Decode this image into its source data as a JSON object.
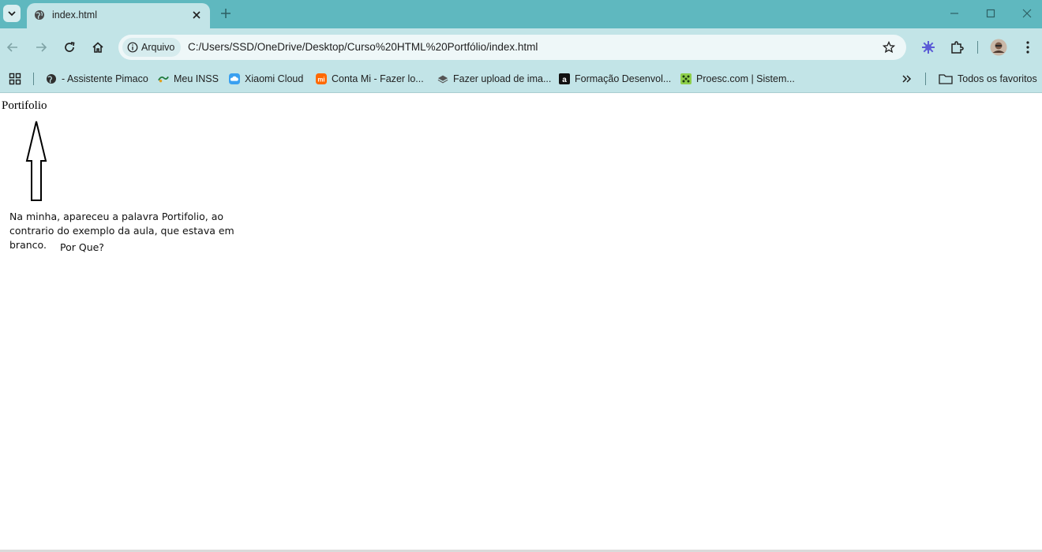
{
  "browser": {
    "tab": {
      "title": "index.html"
    },
    "address": {
      "security_label": "Arquivo",
      "url": "C:/Users/SSD/OneDrive/Desktop/Curso%20HTML%20Portfólio/index.html"
    },
    "bookmarks": [
      {
        "label": "- Assistente Pimaco",
        "icon": "globe-icon"
      },
      {
        "label": "Meu INSS",
        "icon": "inss-icon"
      },
      {
        "label": "Xiaomi Cloud",
        "icon": "cloud-icon"
      },
      {
        "label": "Conta Mi - Fazer lo...",
        "icon": "mi-icon"
      },
      {
        "label": "Fazer upload de ima...",
        "icon": "layers-icon"
      },
      {
        "label": "Formação Desenvol...",
        "icon": "a-icon"
      },
      {
        "label": "Proesc.com | Sistem...",
        "icon": "proesc-icon"
      }
    ],
    "all_bookmarks_label": "Todos os favoritos",
    "colors": {
      "frame": "#5fb8bf",
      "toolbar": "#c2e4e7",
      "omnibox": "#eef7f8"
    }
  },
  "page": {
    "heading": "Portifolio",
    "annotation": {
      "text": "Na minha, apareceu a palavra Portifolio, ao contrario do exemplo da aula, que estava em branco.",
      "question": "Por Que?"
    }
  }
}
